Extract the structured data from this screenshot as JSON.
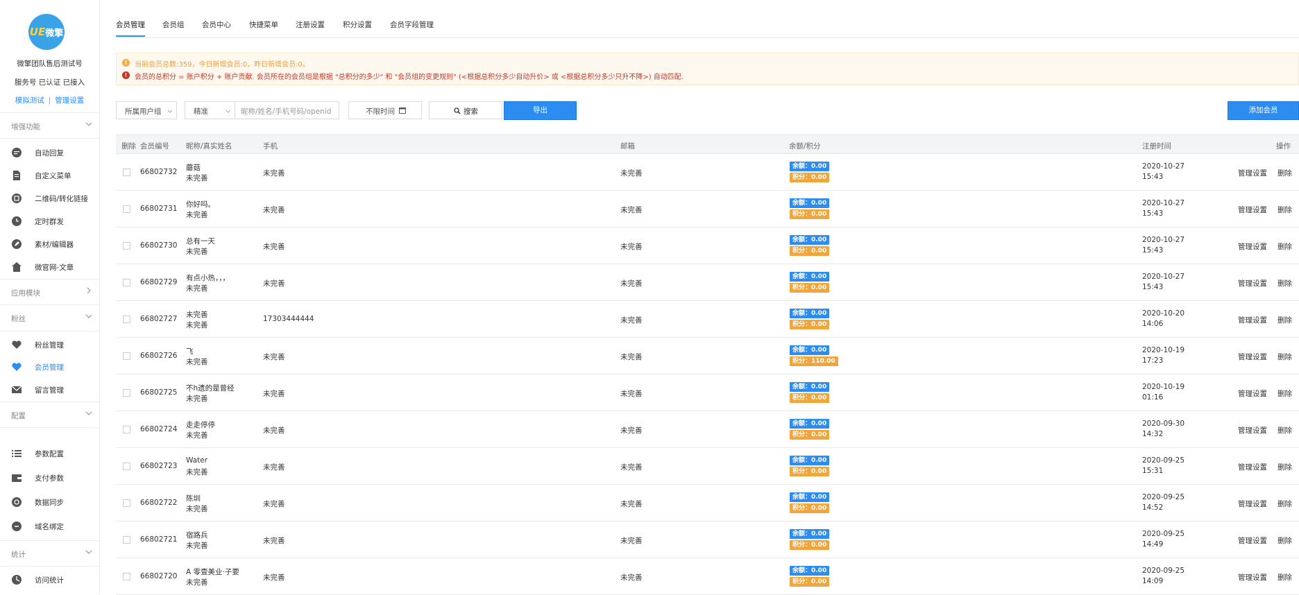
{
  "sidebar": {
    "logo_text": "微擎",
    "account_name": "微擎团队售后测试号",
    "account_status": "服务号 已认证 已接入",
    "link_test": "模拟测试",
    "link_sep": "|",
    "link_manage": "管理设置",
    "sections": [
      {
        "title": "增强功能",
        "chevron": "chevron-down-icon"
      },
      {
        "title": "应用模块",
        "chevron": "chevron-right-icon"
      },
      {
        "title": "粉丝",
        "chevron": "chevron-down-icon"
      },
      {
        "title": "配置",
        "chevron": "chevron-down-icon"
      },
      {
        "title": "统计",
        "chevron": "chevron-down-icon"
      }
    ],
    "items": [
      {
        "label": "自动回复",
        "icon": "chat-icon"
      },
      {
        "label": "自定义菜单",
        "icon": "document-icon"
      },
      {
        "label": "二维码/转化链接",
        "icon": "qrcode-icon"
      },
      {
        "label": "定时群发",
        "icon": "clock-icon"
      },
      {
        "label": "素材/编辑器",
        "icon": "pen-icon"
      },
      {
        "label": "微官网-文章",
        "icon": "home-icon"
      },
      {
        "label": "粉丝管理",
        "icon": "heart-icon"
      },
      {
        "label": "会员管理",
        "icon": "heart-icon"
      },
      {
        "label": "留言管理",
        "icon": "mail-icon"
      },
      {
        "label": "参数配置",
        "icon": "list-icon"
      },
      {
        "label": "支付参数",
        "icon": "wallet-icon"
      },
      {
        "label": "数据同步",
        "icon": "sync-icon"
      },
      {
        "label": "域名绑定",
        "icon": "link-icon"
      },
      {
        "label": "访问统计",
        "icon": "chart-icon"
      }
    ]
  },
  "tabs": [
    "会员管理",
    "会员组",
    "会员中心",
    "快捷菜单",
    "注册设置",
    "积分设置",
    "会员字段管理"
  ],
  "notice": {
    "line1": "当前会员总数:359，今日新增会员:0，昨日新增会员:0。",
    "line2": "会员的总积分 = 账户积分 + 账户贡献. 会员所在的会员组是根据 \"总积分的多少\" 和 \"会员组的变更规则\" (<根据总积分多少自动升价> 或 <根据总积分多少只升不降>) 自动匹配."
  },
  "toolbar": {
    "group_select": "所属用户组",
    "filter_select": "精准",
    "search_placeholder": "昵称/姓名/手机号码/openid",
    "time_select": "不限时间",
    "search_button": "搜索",
    "export_button": "导出",
    "add_button": "添加会员"
  },
  "table": {
    "headers": {
      "delete": "删除",
      "uid": "会员编号",
      "name": "昵称/真实姓名",
      "phone": "手机",
      "email": "邮箱",
      "balance": "余额/积分",
      "regtime": "注册时间",
      "ops": "操作"
    },
    "ops_manage": "管理设置",
    "ops_delete": "删除",
    "rows": [
      {
        "uid": "66802732",
        "nick": "蘑菇",
        "real": "未完善",
        "phone": "未完善",
        "email": "未完善",
        "balance": "余额：0.00",
        "credit": "积分：0.00",
        "date": "2020-10-27",
        "time": "15:43"
      },
      {
        "uid": "66802731",
        "nick": "你好吗。",
        "real": "未完善",
        "phone": "未完善",
        "email": "未完善",
        "balance": "余额：0.00",
        "credit": "积分：0.00",
        "date": "2020-10-27",
        "time": "15:43"
      },
      {
        "uid": "66802730",
        "nick": "总有一天",
        "real": "未完善",
        "phone": "未完善",
        "email": "未完善",
        "balance": "余额：0.00",
        "credit": "积分：0.00",
        "date": "2020-10-27",
        "time": "15:43"
      },
      {
        "uid": "66802729",
        "nick": "有点小热，，，",
        "real": "未完善",
        "phone": "未完善",
        "email": "未完善",
        "balance": "余额：0.00",
        "credit": "积分：0.00",
        "date": "2020-10-27",
        "time": "15:43"
      },
      {
        "uid": "66802727",
        "nick": "未完善",
        "real": "未完善",
        "phone": "17303444444",
        "email": "未完善",
        "balance": "余额：0.00",
        "credit": "积分：0.00",
        "date": "2020-10-20",
        "time": "14:06"
      },
      {
        "uid": "66802726",
        "nick": "飞",
        "real": "未完善",
        "phone": "未完善",
        "email": "未完善",
        "balance": "余额：0.00",
        "credit": "积分：110.00",
        "date": "2020-10-19",
        "time": "17:23"
      },
      {
        "uid": "66802725",
        "nick": "不h遗的是曾经",
        "real": "未完善",
        "phone": "未完善",
        "email": "未完善",
        "balance": "余额：0.00",
        "credit": "积分：0.00",
        "date": "2020-10-19",
        "time": "01:16"
      },
      {
        "uid": "66802724",
        "nick": "走走停停",
        "real": "未完善",
        "phone": "未完善",
        "email": "未完善",
        "balance": "余额：0.00",
        "credit": "积分：0.00",
        "date": "2020-09-30",
        "time": "14:32"
      },
      {
        "uid": "66802723",
        "nick": "Water",
        "real": "未完善",
        "phone": "未完善",
        "email": "未完善",
        "balance": "余额：0.00",
        "credit": "积分：0.00",
        "date": "2020-09-25",
        "time": "15:31"
      },
      {
        "uid": "66802722",
        "nick": "陈圳",
        "real": "未完善",
        "phone": "未完善",
        "email": "未完善",
        "balance": "余额：0.00",
        "credit": "积分：0.00",
        "date": "2020-09-25",
        "time": "14:52"
      },
      {
        "uid": "66802721",
        "nick": "宿路兵",
        "real": "未完善",
        "phone": "未完善",
        "email": "未完善",
        "balance": "余额：0.00",
        "credit": "积分：0.00",
        "date": "2020-09-25",
        "time": "14:49"
      },
      {
        "uid": "66802720",
        "nick": "A 零壹美业·子要",
        "real": "未完善",
        "phone": "未完善",
        "email": "未完善",
        "balance": "余额：0.00",
        "credit": "积分：0.00",
        "date": "2020-09-25",
        "time": "14:09"
      }
    ]
  }
}
